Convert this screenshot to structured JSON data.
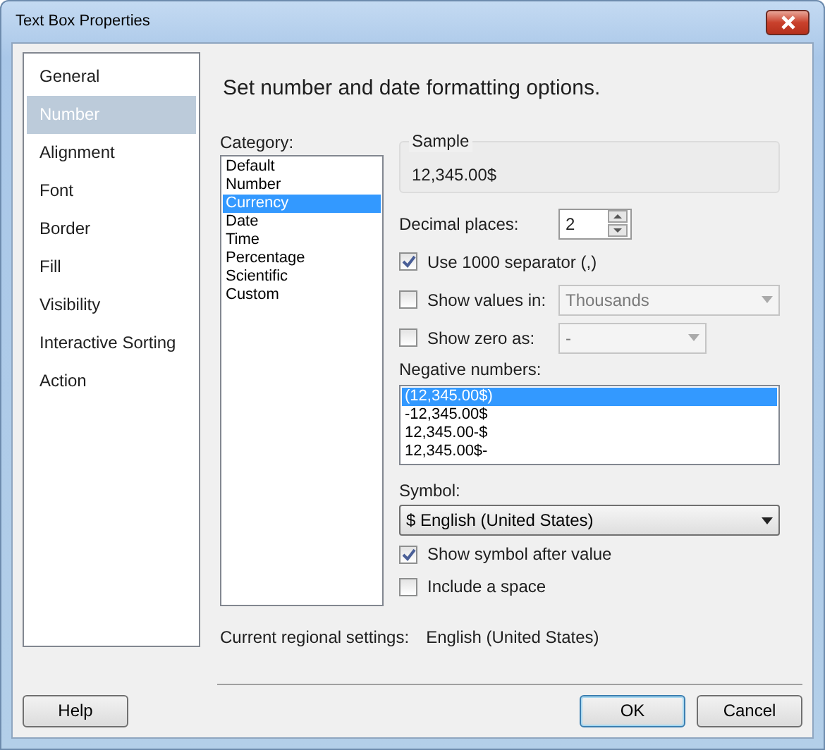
{
  "window": {
    "title": "Text Box Properties"
  },
  "sidebar": {
    "items": [
      {
        "label": "General",
        "selected": false
      },
      {
        "label": "Number",
        "selected": true
      },
      {
        "label": "Alignment",
        "selected": false
      },
      {
        "label": "Font",
        "selected": false
      },
      {
        "label": "Border",
        "selected": false
      },
      {
        "label": "Fill",
        "selected": false
      },
      {
        "label": "Visibility",
        "selected": false
      },
      {
        "label": "Interactive Sorting",
        "selected": false
      },
      {
        "label": "Action",
        "selected": false
      }
    ]
  },
  "heading": "Set number and date formatting options.",
  "category": {
    "label": "Category:",
    "items": [
      {
        "label": "Default",
        "selected": false
      },
      {
        "label": "Number",
        "selected": false
      },
      {
        "label": "Currency",
        "selected": true
      },
      {
        "label": "Date",
        "selected": false
      },
      {
        "label": "Time",
        "selected": false
      },
      {
        "label": "Percentage",
        "selected": false
      },
      {
        "label": "Scientific",
        "selected": false
      },
      {
        "label": "Custom",
        "selected": false
      }
    ]
  },
  "sample": {
    "label": "Sample",
    "value": "12,345.00$"
  },
  "decimal_places": {
    "label": "Decimal places:",
    "value": "2"
  },
  "use_separator": {
    "label": "Use 1000 separator (,)",
    "checked": true
  },
  "show_values_in": {
    "label": "Show values in:",
    "checked": false,
    "value": "Thousands",
    "disabled": true
  },
  "show_zero_as": {
    "label": "Show zero as:",
    "checked": false,
    "value": "-",
    "disabled": true
  },
  "negative_numbers": {
    "label": "Negative numbers:",
    "items": [
      {
        "label": "(12,345.00$)",
        "selected": true
      },
      {
        "label": "-12,345.00$",
        "selected": false
      },
      {
        "label": "12,345.00-$",
        "selected": false
      },
      {
        "label": "12,345.00$-",
        "selected": false
      }
    ]
  },
  "symbol": {
    "label": "Symbol:",
    "value": "$ English (United States)"
  },
  "show_symbol_after": {
    "label": "Show symbol after value",
    "checked": true
  },
  "include_space": {
    "label": "Include a space",
    "checked": false
  },
  "regional": {
    "label": "Current regional settings:",
    "value": "English (United States)"
  },
  "buttons": [
    {
      "label": "Help",
      "default": false
    },
    {
      "label": "OK",
      "default": true
    },
    {
      "label": "Cancel",
      "default": false
    }
  ]
}
